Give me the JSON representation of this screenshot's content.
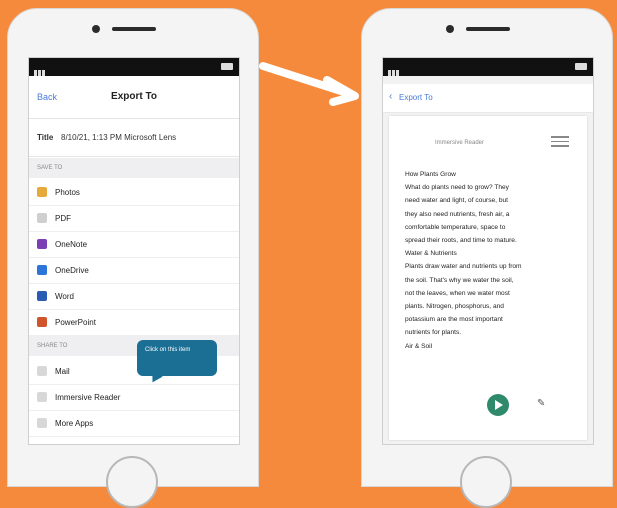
{
  "left_screen": {
    "back_label": "Back",
    "nav_title": "Export To",
    "title_label": "Title",
    "title_value": "8/10/21, 1:13 PM Microsoft Lens",
    "section_save_to": "SAVE TO",
    "save_to_items": [
      {
        "label": "Photos",
        "icon": "photos-icon",
        "color": "#e7a93c"
      },
      {
        "label": "PDF",
        "icon": "pdf-icon",
        "color": "#cfcfcf"
      },
      {
        "label": "OneNote",
        "icon": "onenote-icon",
        "color": "#7b3fb5"
      },
      {
        "label": "OneDrive",
        "icon": "onedrive-icon",
        "color": "#2b74d8"
      },
      {
        "label": "Word",
        "icon": "word-icon",
        "color": "#2b5bb5"
      },
      {
        "label": "PowerPoint",
        "icon": "powerpoint-icon",
        "color": "#d0552c"
      }
    ],
    "section_share_to": "SHARE TO",
    "share_to_items": [
      {
        "label": "Mail",
        "icon": "mail-icon",
        "color": "#d8d8d8"
      },
      {
        "label": "Immersive Reader",
        "icon": "immersive-reader-icon",
        "color": "#d8d8d8"
      },
      {
        "label": "More Apps",
        "icon": "more-apps-icon",
        "color": "#d8d8d8"
      }
    ],
    "tooltip_text": "Click on this item"
  },
  "right_screen": {
    "back_label": "Export To",
    "reader_title": "Immersive Reader",
    "reader_lines": [
      "How Plants Grow",
      "What do plants need to grow? They",
      "need water and light, of course, but",
      "they also need nutrients, fresh air, a",
      "comfortable temperature, space to",
      "spread their roots, and time to mature.",
      "Water & Nutrients",
      "Plants draw water and nutrients up from",
      "the soil. That's why we water the soil,",
      "not the leaves, when we water most",
      "plants. Nitrogen, phosphorus, and",
      "potassium are the most important",
      "nutrients for plants.",
      "Air & Soil"
    ],
    "play_color": "#2e8a6a"
  },
  "colors": {
    "background": "#f68a3c",
    "accent": "#4a7bd6",
    "tooltip": "#1c6f94"
  }
}
